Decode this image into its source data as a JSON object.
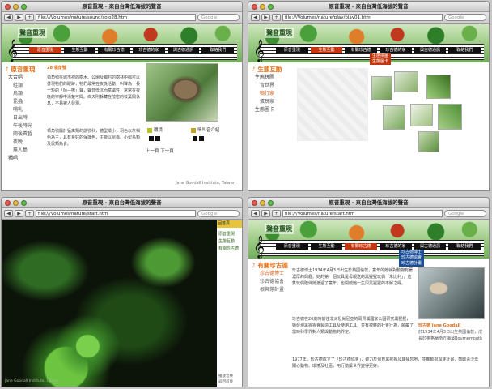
{
  "windows": [
    {
      "title": "原音重現 - 來自台灣低海拔的聲音",
      "url": "file:///Volumes/nature/sound/solo28.htm",
      "search_placeholder": "Google",
      "logo": "聲音重現",
      "logo_sub": "原音重現",
      "menu": [
        "原音重現",
        "生態互動",
        "有關珍古德",
        "珍古德的家",
        "與古德通訊",
        "聯絡我們"
      ],
      "active_menu": 0,
      "section_title": "原音重現",
      "nav": [
        {
          "label": "大合唱",
          "sub": false
        },
        {
          "label": "蛙類",
          "sub": true
        },
        {
          "label": "鳥類",
          "sub": true
        },
        {
          "label": "昆蟲",
          "sub": true
        },
        {
          "label": "哺乳",
          "sub": true
        },
        {
          "label": "日出時",
          "sub": true
        },
        {
          "label": "午後時光",
          "sub": true
        },
        {
          "label": "雨後黃昏",
          "sub": true
        },
        {
          "label": "夜晚",
          "sub": true
        },
        {
          "label": "無人島",
          "sub": true
        },
        {
          "label": "獨唱",
          "sub": false
        }
      ],
      "item_number": "28 領角鴞",
      "paragraph1": "領角鴞在城市裡的樹木、公園及鄉村的樹林中都可以發現牠們的蹤跡，牠們最常在夜晚活動，叫聲為一長一短的「咕—嗚」聲，聲音低沉而富磁性，常常在夜晚的寧靜中清楚可聞。白天則躲藏在茂密的枝葉間休息，不易被人發現。",
      "paragraph2": "領角鴞屬於猛禽類的鴟鴞科，體型嬌小，羽色以灰褐色為主，具有良好的保護色，主要以昆蟲、小型鳥類及鼠類為食。",
      "ctrl_environment": "環境",
      "ctrl_narration": "鳴叫音介紹",
      "pager": "上一頁 下一頁",
      "footer": "Jane Goodall Institute, Taiwan"
    },
    {
      "title": "原音重現 - 來自台灣低海拔的聲音",
      "url": "file:///Volumes/nature/play/play01.htm",
      "search_placeholder": "Google",
      "logo": "聲音重現",
      "menu": [
        "原音重現",
        "生態互動",
        "有關珍古德",
        "珍古德的家",
        "與古德通訊",
        "聯絡我們"
      ],
      "active_menu": 1,
      "dropdown": [
        "生態拼圖",
        "生態拼圖",
        "生態圖卡"
      ],
      "section_title": "生態互動",
      "nav": [
        {
          "label": "生態拼圖",
          "sub": false,
          "on": false
        },
        {
          "label": "青世界",
          "sub": true,
          "on": false
        },
        {
          "label": "鳴行家",
          "sub": true,
          "on": true
        },
        {
          "label": "蛋玩家",
          "sub": true,
          "on": false
        },
        {
          "label": "生態圖卡",
          "sub": false,
          "on": false
        }
      ]
    },
    {
      "title": "原音重現 - 來自台灣低海拔的聲音",
      "url": "file:///Volumes/nature/start.htm",
      "search_placeholder": "Google",
      "side_tab": "回首頁",
      "side_links": [
        "原音重現",
        "生態互動",
        "有關珍古德"
      ],
      "side_footer": [
        "播放音樂",
        "返回首頁"
      ],
      "credit": "Jane Goodall Institute, Taiwan"
    },
    {
      "title": "原音重現 - 來自台灣低海拔的聲音",
      "url": "file:///Volumes/nature/start.htm",
      "search_placeholder": "Google",
      "logo": "聲音重現",
      "menu": [
        "原音重現",
        "生態互動",
        "有關珍古德",
        "珍古德的家",
        "與古德通訊",
        "聯絡我們"
      ],
      "active_menu": 2,
      "dropdown": [
        "珍古德博士",
        "珍古德協會",
        "珍古德計畫"
      ],
      "section_title": "有關珍古德",
      "nav": [
        {
          "label": "珍古德博士",
          "sub": false,
          "on": true
        },
        {
          "label": "珍古德協會",
          "sub": false,
          "on": false
        },
        {
          "label": "根與芽計畫",
          "sub": false,
          "on": false
        }
      ],
      "paragraph1": "珍古德博士1934年4月3日出生於英國倫敦，童年的她就對動物有著濃厚的興趣。她的第一個玩具是母親送的黑猩猩玩偶「朱比利」，這隻玩偶陪伴她渡過了童年，也開啟她一生與黑猩猩的不解之緣。",
      "paragraph2": "珍古德在26歲時前往非洲坦尚尼亞的岡貝溪國家公園研究黑猩猩，她發現黑猩猩會製造工具及使用工具，並有複雜的社會行為，顛覆了當時科學界對人類與動物的界定。",
      "paragraph3": "1977年，珍古德成立了「珍古德協會」，致力於保育黑猩猩及其棲息地，並推動根與芽計畫，鼓勵青少年關心動物、環境及社區，用行動讓世界變得更好。",
      "caption_name": "珍古德 Jane Goodall",
      "caption_text": "於1934年4月3日出生英國倫敦，成長於英格蘭南方海濱Bournemouth"
    }
  ],
  "colors": {
    "accent": "#e0701b",
    "menu_active": "#c4360f",
    "menu": "#111111",
    "dropdown_blue": "#1b4d96"
  }
}
